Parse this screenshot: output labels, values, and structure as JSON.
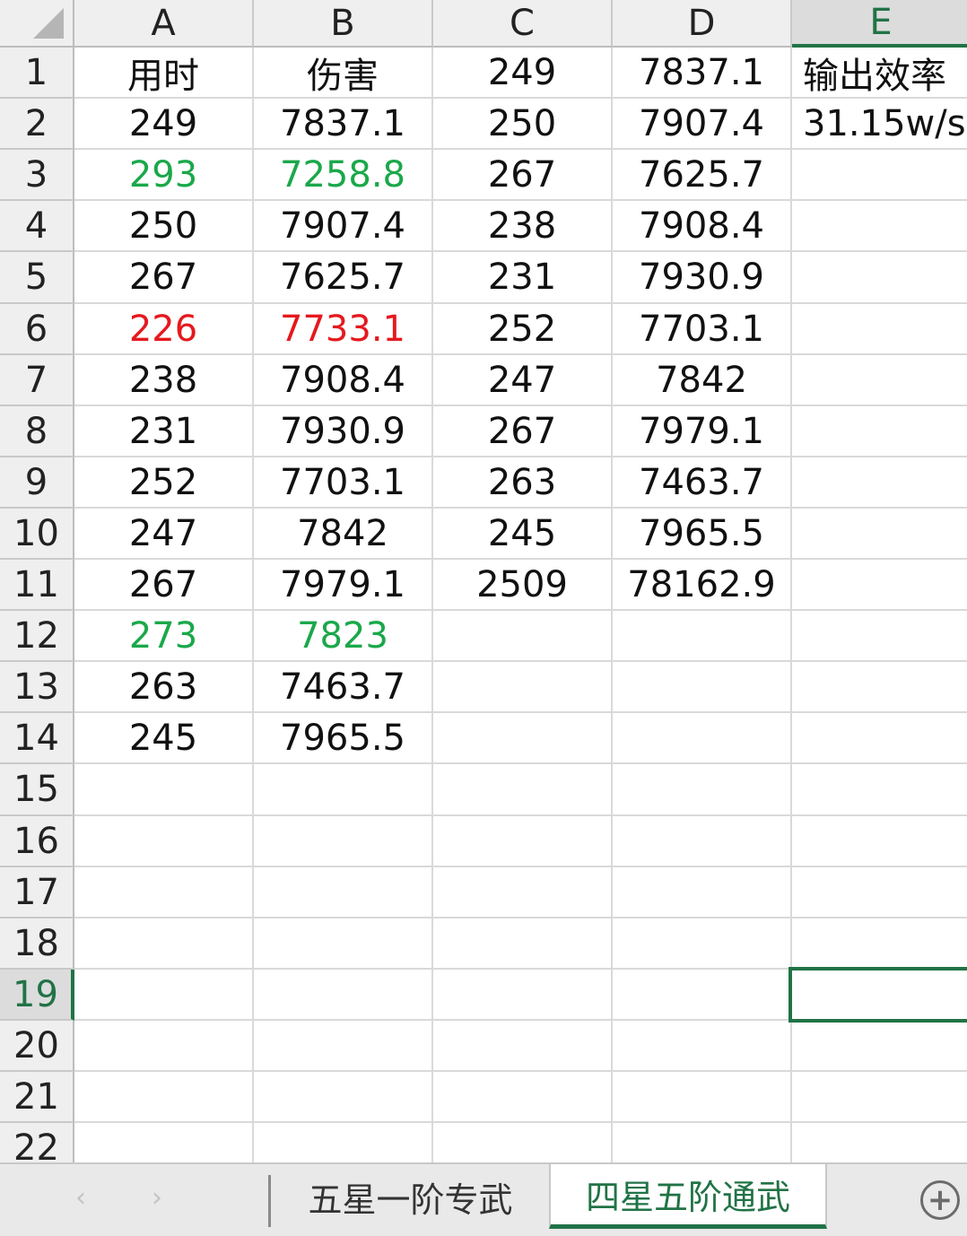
{
  "columns": [
    "A",
    "B",
    "C",
    "D",
    "E"
  ],
  "selected_column": "E",
  "rows": [
    "1",
    "2",
    "3",
    "4",
    "5",
    "6",
    "7",
    "8",
    "9",
    "10",
    "11",
    "12",
    "13",
    "14",
    "15",
    "16",
    "17",
    "18",
    "19",
    "20",
    "21",
    "22"
  ],
  "selected_row": "19",
  "cells": {
    "A1": "用时",
    "B1": "伤害",
    "C1": "249",
    "D1": "7837.1",
    "E1": "输出效率",
    "A2": "249",
    "B2": "7837.1",
    "C2": "250",
    "D2": "7907.4",
    "E2": "31.15w/s",
    "A3": "293",
    "B3": "7258.8",
    "C3": "267",
    "D3": "7625.7",
    "A4": "250",
    "B4": "7907.4",
    "C4": "238",
    "D4": "7908.4",
    "A5": "267",
    "B5": "7625.7",
    "C5": "231",
    "D5": "7930.9",
    "A6": "226",
    "B6": "7733.1",
    "C6": "252",
    "D6": "7703.1",
    "A7": "238",
    "B7": "7908.4",
    "C7": "247",
    "D7": "7842",
    "A8": "231",
    "B8": "7930.9",
    "C8": "267",
    "D8": "7979.1",
    "A9": "252",
    "B9": "7703.1",
    "C9": "263",
    "D9": "7463.7",
    "A10": "247",
    "B10": "7842",
    "C10": "245",
    "D10": "7965.5",
    "A11": "267",
    "B11": "7979.1",
    "C11": "2509",
    "D11": "78162.9",
    "A12": "273",
    "B12": "7823",
    "A13": "263",
    "B13": "7463.7",
    "A14": "245",
    "B14": "7965.5"
  },
  "cell_colors": {
    "A3": "#1aa84a",
    "B3": "#1aa84a",
    "A6": "#e5191e",
    "B6": "#e5191e",
    "A12": "#1aa84a",
    "B12": "#1aa84a"
  },
  "active_cell": "E19",
  "sheet_tabs": [
    {
      "label": "五星一阶专武",
      "active": false
    },
    {
      "label": "四星五阶通武",
      "active": true
    }
  ],
  "accent_color": "#217346",
  "icons": {
    "prev": "chevron-left-icon",
    "next": "chevron-right-icon",
    "add": "plus-circle-icon"
  }
}
